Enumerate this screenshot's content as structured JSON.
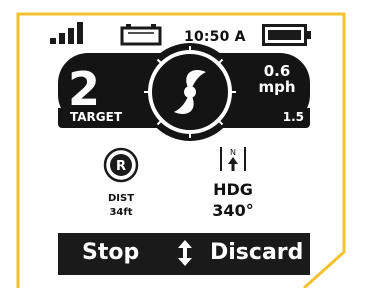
{
  "status_bar": {
    "time": "10:50 A",
    "signal_icon": "signal-bars-icon",
    "secondary_battery_icon": "battery-outline-icon",
    "main_battery_icon": "battery-full-icon"
  },
  "speed_panel": {
    "target_number": "2",
    "speed_value": "0.6",
    "speed_unit": "mph",
    "dial_icon": "propeller-dial-icon",
    "target_label": "TARGET",
    "target_value": "1.5"
  },
  "record": {
    "icon_letter": "R",
    "distance_label": "DIST",
    "distance_value": "34ft"
  },
  "heading": {
    "compass_letter": "N",
    "label": "HDG",
    "value": "340°"
  },
  "softkeys": {
    "left_label": "Stop",
    "right_label": "Discard",
    "center_icon": "up-down-arrow-icon"
  },
  "colors": {
    "frame": "#f2c12e",
    "panel": "#141414",
    "text": "#111111"
  }
}
